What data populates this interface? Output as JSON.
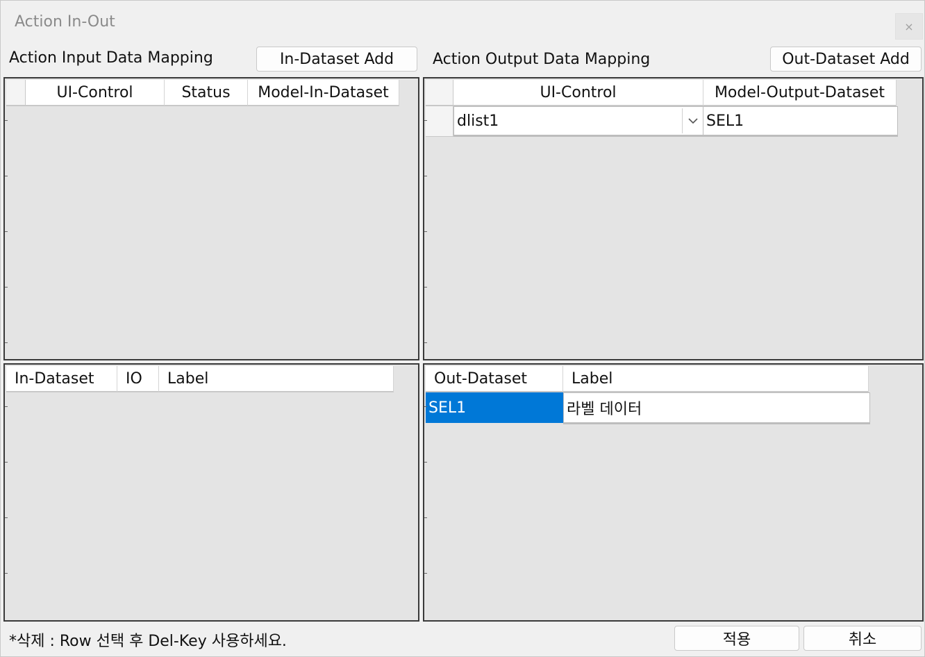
{
  "window": {
    "title": "Action In-Out",
    "close_glyph": "×"
  },
  "input_section": {
    "label": "Action Input Data Mapping",
    "add_button": "In-Dataset Add",
    "grid": {
      "columns": [
        "",
        "UI-Control",
        "Status",
        "Model-In-Dataset"
      ]
    },
    "dataset_grid": {
      "columns": [
        "In-Dataset",
        "IO",
        "Label"
      ]
    }
  },
  "output_section": {
    "label": "Action Output Data Mapping",
    "add_button": "Out-Dataset Add",
    "grid": {
      "columns": [
        "",
        "UI-Control",
        "Model-Output-Dataset"
      ],
      "rows": [
        {
          "ui_control": "dlist1",
          "model_output_dataset": "SEL1"
        }
      ]
    },
    "dataset_grid": {
      "columns": [
        "Out-Dataset",
        "Label"
      ],
      "rows": [
        {
          "out_dataset": "SEL1",
          "label": "라벨 데이터"
        }
      ]
    }
  },
  "footer": {
    "hint": "*삭제 : Row 선택 후 Del-Key 사용하세요.",
    "apply_button": "적용",
    "cancel_button": "취소"
  },
  "colors": {
    "selection": "#0078d7",
    "panel_bg": "#e4e4e4"
  },
  "icons": {
    "close": "close-icon",
    "dropdown": "chevron-down-icon"
  }
}
